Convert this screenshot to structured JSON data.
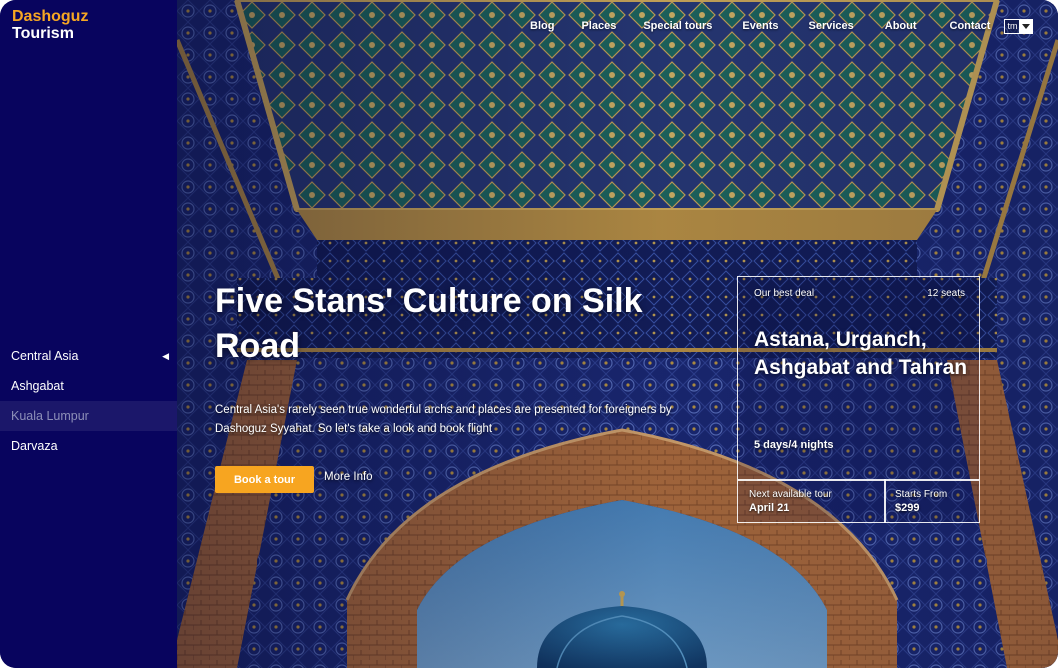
{
  "brand": {
    "line1": "Dashoguz",
    "line2": "Tourism"
  },
  "sidebar": {
    "items": [
      {
        "label": "Central Asia",
        "arrow": "◀"
      },
      {
        "label": "Ashgabat"
      },
      {
        "label": "Kuala Lumpur"
      },
      {
        "label": "Darvaza"
      }
    ]
  },
  "nav": {
    "links": [
      "Blog",
      "Places",
      "Special tours",
      "Events",
      "Services",
      "About",
      "Contact"
    ],
    "language": "tm"
  },
  "hero": {
    "title": "Five Stans' Culture on Silk Road",
    "description": "Central Asia's rarely seen true wonderful archs and places are presented for foreigners by Dashoguz Syyahat. So let's take a look and book flight",
    "book_button": "Book a tour",
    "more_link": "More Info"
  },
  "deal": {
    "label": "Our best deal",
    "seats": "12 seats",
    "title": "Astana, Urganch, Ashgabat and Tahran",
    "duration": "5 days/4 nights",
    "next_label": "Next available tour",
    "next_value": "April 21",
    "price_label": "Starts From",
    "price_value": "$299"
  },
  "colors": {
    "sidebar_bg": "#08045e",
    "brand_accent": "#f5a623",
    "button_bg": "#f7a520"
  }
}
